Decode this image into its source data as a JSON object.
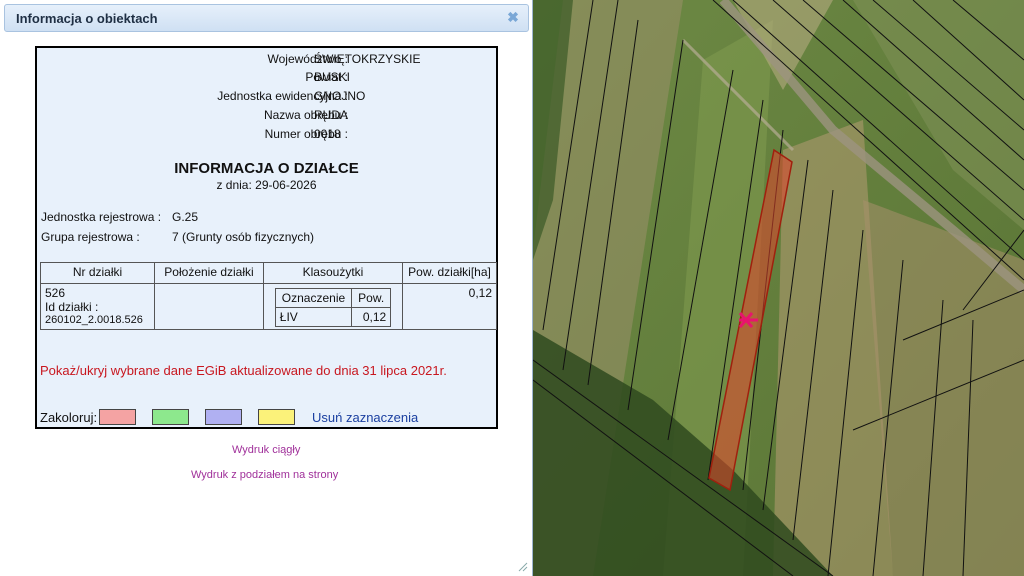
{
  "dialog": {
    "title": "Informacja o obiektach",
    "close_icon": "✖"
  },
  "location": [
    {
      "key": "Województwo :",
      "value": "ŚWIĘTOKRZYSKIE"
    },
    {
      "key": "Powiat :",
      "value": "BUSKI"
    },
    {
      "key": "Jednostka ewidencyjna :",
      "value": "GNOJNO"
    },
    {
      "key": "Nazwa obrębu :",
      "value": "RUDA"
    },
    {
      "key": "Numer obrębu :",
      "value": "0018"
    }
  ],
  "info": {
    "title": "INFORMACJA O DZIAŁCE",
    "date": "z dnia: 29-06-2026"
  },
  "registry": {
    "unit_label": "Jednostka rejestrowa :",
    "unit_value": "G.25",
    "group_label": "Grupa rejestrowa :",
    "group_value": "7 (Grunty osób fizycznych)"
  },
  "table": {
    "headers": [
      "Nr działki",
      "Położenie działki",
      "Klasoużytki",
      "Pow. działki[ha]"
    ],
    "parcel_number": "526",
    "parcel_id_label": "Id działki :",
    "parcel_id": "260102_2.0018.526",
    "location": "",
    "class_headers": [
      "Oznaczenie",
      "Pow."
    ],
    "class_rows": [
      {
        "code": "ŁIV",
        "area": "0,12"
      }
    ],
    "area": "0,12"
  },
  "note": "Pokaż/ukryj wybrane dane EGiB aktualizowane do dnia 31 lipca 2021r.",
  "colorize": {
    "label": "Zakoloruj:",
    "swatches": [
      "#f4a3a3",
      "#8de88d",
      "#b0b0f2",
      "#fbf27a"
    ],
    "clear_label": "Usuń zaznaczenia"
  },
  "links": {
    "continuous": "Wydruk ciągły",
    "paged": "Wydruk z podziałem na strony"
  },
  "map": {
    "selected_parcel_color": "#e0442c",
    "marker_color": "#e8146e",
    "marker_icon": "x-marker"
  }
}
